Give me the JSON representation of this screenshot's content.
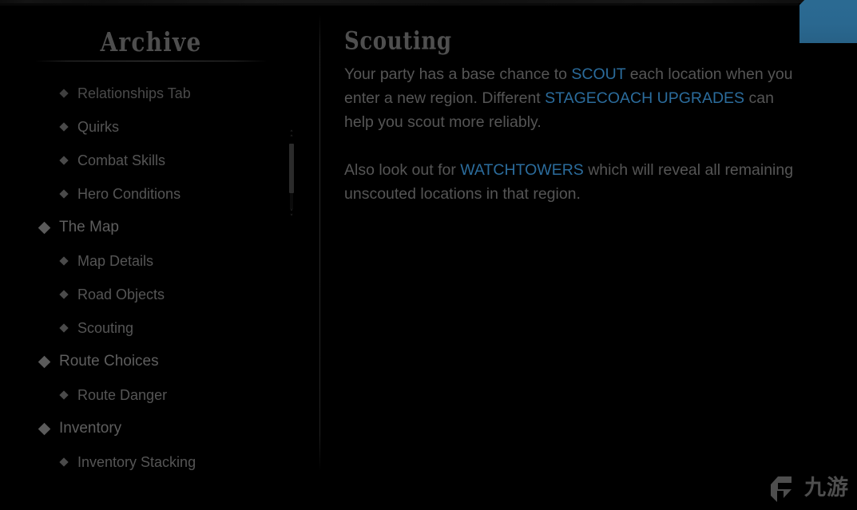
{
  "sidebar": {
    "title": "Archive",
    "items": [
      {
        "label": "Relationships Tab",
        "level": 1,
        "faded": true
      },
      {
        "label": "Quirks",
        "level": 1,
        "faded": false
      },
      {
        "label": "Combat Skills",
        "level": 1,
        "faded": false
      },
      {
        "label": "Hero Conditions",
        "level": 1,
        "faded": false
      },
      {
        "label": "The Map",
        "level": 0,
        "faded": false
      },
      {
        "label": "Map Details",
        "level": 1,
        "faded": false
      },
      {
        "label": "Road Objects",
        "level": 1,
        "faded": false
      },
      {
        "label": "Scouting",
        "level": 1,
        "faded": false
      },
      {
        "label": "Route Choices",
        "level": 0,
        "faded": false
      },
      {
        "label": "Route Danger",
        "level": 1,
        "faded": false
      },
      {
        "label": "Inventory",
        "level": 0,
        "faded": false
      },
      {
        "label": "Inventory Stacking",
        "level": 1,
        "faded": false
      }
    ],
    "scrollbar": {
      "up_chevron": "˄",
      "down_chevron": "˅"
    }
  },
  "content": {
    "title": "Scouting",
    "paragraphs": [
      [
        {
          "text": "Your party has a base chance to ",
          "keyword": false
        },
        {
          "text": "SCOUT",
          "keyword": true
        },
        {
          "text": " each location when you enter a new region. Different ",
          "keyword": false
        },
        {
          "text": "STAGECOACH UPGRADES",
          "keyword": true
        },
        {
          "text": " can help you scout more reliably.",
          "keyword": false
        }
      ],
      [
        {
          "text": "Also look out for ",
          "keyword": false
        },
        {
          "text": "WATCHTOWERS",
          "keyword": true
        },
        {
          "text": " which will reveal all remaining unscouted locations in that region.",
          "keyword": false
        }
      ]
    ]
  },
  "watermark": {
    "text": "九游"
  },
  "colors": {
    "background": "#000000",
    "keyword_link": "#2b6c9c",
    "body_text": "#555555",
    "heading_text": "#4f4f4f",
    "accent_corner": "#2d6d96"
  }
}
